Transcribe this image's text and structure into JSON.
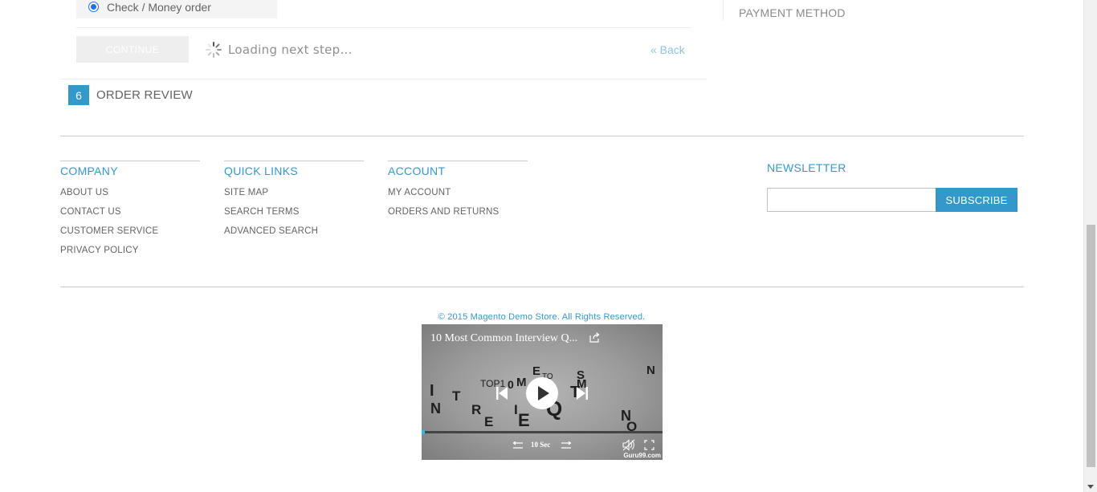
{
  "checkout": {
    "payment_option_label": "Check / Money order",
    "continue_label": "CONTINUE",
    "loading_text": "Loading next step...",
    "back_label": "« Back",
    "step_number": "6",
    "step_title": "ORDER REVIEW"
  },
  "progress_sidebar": {
    "payment_method": "PAYMENT METHOD"
  },
  "footer": {
    "company": {
      "title": "COMPANY",
      "links": [
        "ABOUT US",
        "CONTACT US",
        "CUSTOMER SERVICE",
        "PRIVACY POLICY"
      ]
    },
    "quick_links": {
      "title": "QUICK LINKS",
      "links": [
        "SITE MAP",
        "SEARCH TERMS",
        "ADVANCED SEARCH"
      ]
    },
    "account": {
      "title": "ACCOUNT",
      "links": [
        "MY ACCOUNT",
        "ORDERS AND RETURNS"
      ]
    },
    "newsletter": {
      "title": "NEWSLETTER",
      "input_value": "",
      "subscribe_label": "SUBSCRIBE"
    },
    "copyright": "© 2015 Magento Demo Store. All Rights Reserved."
  },
  "video": {
    "title": "10 Most Common Interview Q...",
    "skip_label": "10 Sec",
    "watermark": "Guru99.com",
    "progress": 0.01,
    "icons": [
      "share-icon",
      "previous-icon",
      "play-icon",
      "next-icon",
      "rewind-icon",
      "forward-icon",
      "mute-icon",
      "fullscreen-icon"
    ]
  },
  "colors": {
    "accent": "#3399cc",
    "text": "#636363",
    "video_progress": "#29b6f6"
  }
}
